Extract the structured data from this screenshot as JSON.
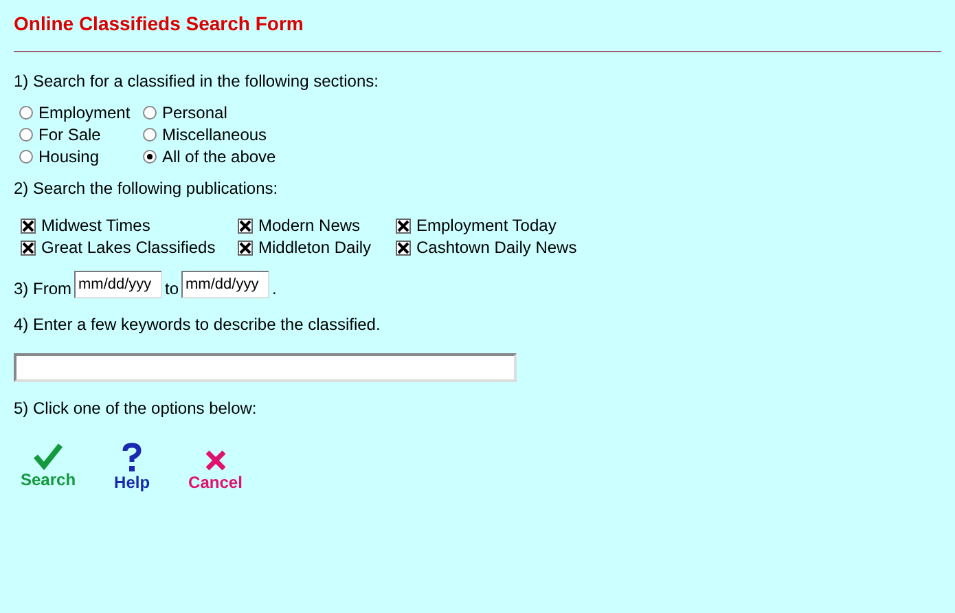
{
  "title": "Online Classifieds Search Form",
  "sections": {
    "prompt": "1) Search for a classified in the following sections:",
    "options": [
      {
        "label": "Employment",
        "selected": false
      },
      {
        "label": "For Sale",
        "selected": false
      },
      {
        "label": "Housing",
        "selected": false
      },
      {
        "label": "Personal",
        "selected": false
      },
      {
        "label": "Miscellaneous",
        "selected": false
      },
      {
        "label": "All of the above",
        "selected": true
      }
    ]
  },
  "publications": {
    "prompt": "2) Search the following publications:",
    "options": [
      {
        "label": "Midwest Times",
        "checked": true
      },
      {
        "label": "Great Lakes Classifieds",
        "checked": true
      },
      {
        "label": "Modern News",
        "checked": true
      },
      {
        "label": "Middleton Daily",
        "checked": true
      },
      {
        "label": "Employment Today",
        "checked": true
      },
      {
        "label": "Cashtown Daily News",
        "checked": true
      }
    ]
  },
  "dates": {
    "from_label": "3) From",
    "from_value": "mm/dd/yyy",
    "to_label": "to",
    "to_value": "mm/dd/yyy",
    "end": "."
  },
  "keywords": {
    "prompt": "4) Enter a few keywords to describe the classified."
  },
  "actions": {
    "prompt": "5) Click one of the options below:",
    "buttons": [
      {
        "label": "Search",
        "kind": "check",
        "color": "#129a3c"
      },
      {
        "label": "Help",
        "kind": "question",
        "color": "#1a2ab0"
      },
      {
        "label": "Cancel",
        "kind": "cross",
        "color": "#e0126e"
      }
    ]
  }
}
